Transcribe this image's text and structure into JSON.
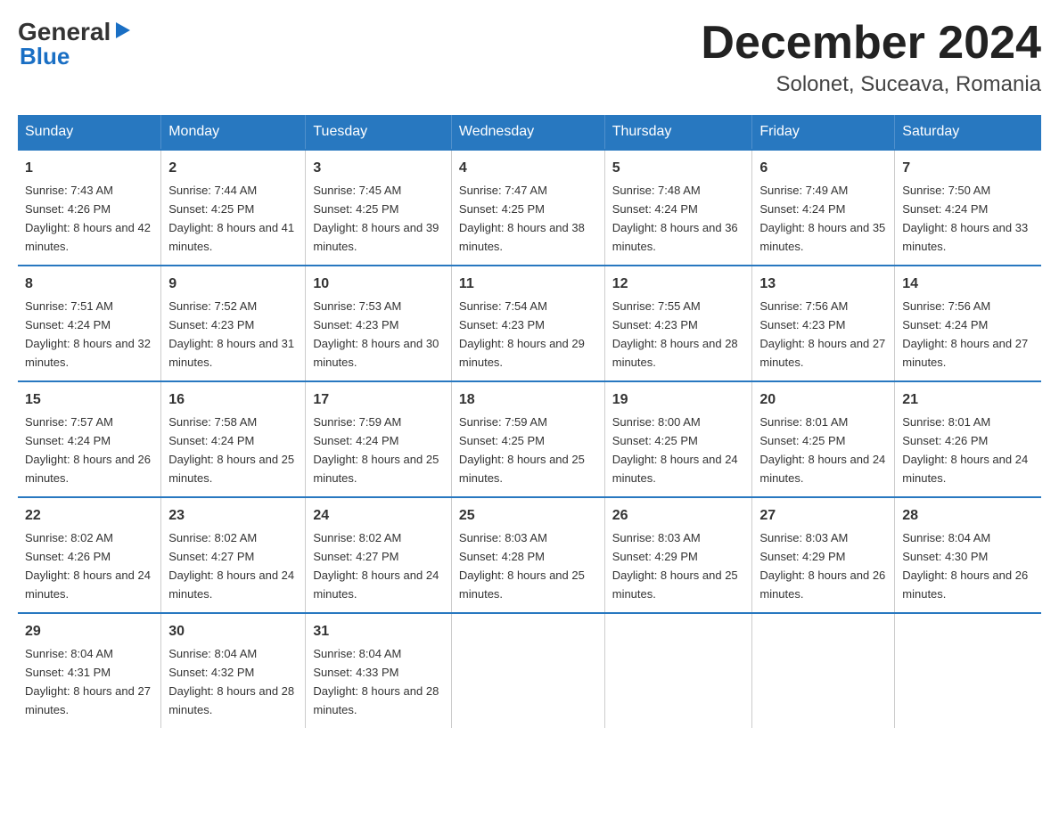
{
  "header": {
    "logo_line1_part1": "General",
    "logo_line2": "Blue",
    "title": "December 2024",
    "subtitle": "Solonet, Suceava, Romania"
  },
  "calendar": {
    "days_of_week": [
      "Sunday",
      "Monday",
      "Tuesday",
      "Wednesday",
      "Thursday",
      "Friday",
      "Saturday"
    ],
    "weeks": [
      [
        {
          "day": "1",
          "sunrise": "7:43 AM",
          "sunset": "4:26 PM",
          "daylight": "8 hours and 42 minutes."
        },
        {
          "day": "2",
          "sunrise": "7:44 AM",
          "sunset": "4:25 PM",
          "daylight": "8 hours and 41 minutes."
        },
        {
          "day": "3",
          "sunrise": "7:45 AM",
          "sunset": "4:25 PM",
          "daylight": "8 hours and 39 minutes."
        },
        {
          "day": "4",
          "sunrise": "7:47 AM",
          "sunset": "4:25 PM",
          "daylight": "8 hours and 38 minutes."
        },
        {
          "day": "5",
          "sunrise": "7:48 AM",
          "sunset": "4:24 PM",
          "daylight": "8 hours and 36 minutes."
        },
        {
          "day": "6",
          "sunrise": "7:49 AM",
          "sunset": "4:24 PM",
          "daylight": "8 hours and 35 minutes."
        },
        {
          "day": "7",
          "sunrise": "7:50 AM",
          "sunset": "4:24 PM",
          "daylight": "8 hours and 33 minutes."
        }
      ],
      [
        {
          "day": "8",
          "sunrise": "7:51 AM",
          "sunset": "4:24 PM",
          "daylight": "8 hours and 32 minutes."
        },
        {
          "day": "9",
          "sunrise": "7:52 AM",
          "sunset": "4:23 PM",
          "daylight": "8 hours and 31 minutes."
        },
        {
          "day": "10",
          "sunrise": "7:53 AM",
          "sunset": "4:23 PM",
          "daylight": "8 hours and 30 minutes."
        },
        {
          "day": "11",
          "sunrise": "7:54 AM",
          "sunset": "4:23 PM",
          "daylight": "8 hours and 29 minutes."
        },
        {
          "day": "12",
          "sunrise": "7:55 AM",
          "sunset": "4:23 PM",
          "daylight": "8 hours and 28 minutes."
        },
        {
          "day": "13",
          "sunrise": "7:56 AM",
          "sunset": "4:23 PM",
          "daylight": "8 hours and 27 minutes."
        },
        {
          "day": "14",
          "sunrise": "7:56 AM",
          "sunset": "4:24 PM",
          "daylight": "8 hours and 27 minutes."
        }
      ],
      [
        {
          "day": "15",
          "sunrise": "7:57 AM",
          "sunset": "4:24 PM",
          "daylight": "8 hours and 26 minutes."
        },
        {
          "day": "16",
          "sunrise": "7:58 AM",
          "sunset": "4:24 PM",
          "daylight": "8 hours and 25 minutes."
        },
        {
          "day": "17",
          "sunrise": "7:59 AM",
          "sunset": "4:24 PM",
          "daylight": "8 hours and 25 minutes."
        },
        {
          "day": "18",
          "sunrise": "7:59 AM",
          "sunset": "4:25 PM",
          "daylight": "8 hours and 25 minutes."
        },
        {
          "day": "19",
          "sunrise": "8:00 AM",
          "sunset": "4:25 PM",
          "daylight": "8 hours and 24 minutes."
        },
        {
          "day": "20",
          "sunrise": "8:01 AM",
          "sunset": "4:25 PM",
          "daylight": "8 hours and 24 minutes."
        },
        {
          "day": "21",
          "sunrise": "8:01 AM",
          "sunset": "4:26 PM",
          "daylight": "8 hours and 24 minutes."
        }
      ],
      [
        {
          "day": "22",
          "sunrise": "8:02 AM",
          "sunset": "4:26 PM",
          "daylight": "8 hours and 24 minutes."
        },
        {
          "day": "23",
          "sunrise": "8:02 AM",
          "sunset": "4:27 PM",
          "daylight": "8 hours and 24 minutes."
        },
        {
          "day": "24",
          "sunrise": "8:02 AM",
          "sunset": "4:27 PM",
          "daylight": "8 hours and 24 minutes."
        },
        {
          "day": "25",
          "sunrise": "8:03 AM",
          "sunset": "4:28 PM",
          "daylight": "8 hours and 25 minutes."
        },
        {
          "day": "26",
          "sunrise": "8:03 AM",
          "sunset": "4:29 PM",
          "daylight": "8 hours and 25 minutes."
        },
        {
          "day": "27",
          "sunrise": "8:03 AM",
          "sunset": "4:29 PM",
          "daylight": "8 hours and 26 minutes."
        },
        {
          "day": "28",
          "sunrise": "8:04 AM",
          "sunset": "4:30 PM",
          "daylight": "8 hours and 26 minutes."
        }
      ],
      [
        {
          "day": "29",
          "sunrise": "8:04 AM",
          "sunset": "4:31 PM",
          "daylight": "8 hours and 27 minutes."
        },
        {
          "day": "30",
          "sunrise": "8:04 AM",
          "sunset": "4:32 PM",
          "daylight": "8 hours and 28 minutes."
        },
        {
          "day": "31",
          "sunrise": "8:04 AM",
          "sunset": "4:33 PM",
          "daylight": "8 hours and 28 minutes."
        },
        null,
        null,
        null,
        null
      ]
    ],
    "labels": {
      "sunrise": "Sunrise:",
      "sunset": "Sunset:",
      "daylight": "Daylight:"
    }
  }
}
